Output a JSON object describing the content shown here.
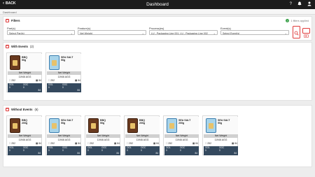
{
  "header": {
    "back_label": "BACK",
    "title": "Dashboard"
  },
  "breadcrumb": "Dashboard",
  "filters": {
    "title": "Filters",
    "applied_text": "1 filters applied",
    "fields": [
      {
        "label": "Part(s)",
        "value": "Select Part(s)"
      },
      {
        "label": "Feature(s)",
        "value": "Net Weight"
      },
      {
        "label": "Process(es)",
        "value": "LU - Packaging Line 001, LU - Packaging Line 002"
      },
      {
        "label": "Event(s)",
        "value": "Select Event(s)"
      }
    ]
  },
  "with_events": {
    "title": "With Events",
    "count": "(2)",
    "cards": [
      {
        "flavor": "BBQ",
        "weight": "50g",
        "bag": "dark",
        "measure": "Net Weight",
        "value": "11946 AGG",
        "left_count": "252",
        "right_count": "84",
        "stat1": "OOL",
        "stat1_val": "0",
        "stat2": "OOC",
        "stat2_val": "0",
        "stat3": "84"
      },
      {
        "flavor": "SEA SALT",
        "weight": "50g",
        "bag": "light",
        "measure": "Net Weight",
        "value": "11946 AGG",
        "left_count": "252",
        "right_count": "84",
        "stat1": "OOL",
        "stat1_val": "0",
        "stat2": "OOC",
        "stat2_val": "0",
        "stat3": "84"
      }
    ]
  },
  "without_events": {
    "title": "Without Events",
    "count": "(6)",
    "cards": [
      {
        "flavor": "BBQ",
        "weight": "200g",
        "bag": "dark",
        "measure": "Net Weight",
        "value": "11946 AGG",
        "left_count": "252",
        "right_count": "84",
        "stat1": "OOL",
        "stat1_val": "0",
        "stat2": "OOC",
        "stat2_val": "0",
        "stat3": "84"
      },
      {
        "flavor": "SEA SALT",
        "weight": "50g",
        "bag": "light",
        "measure": "Net Weight",
        "value": "11946 AGG",
        "left_count": "252",
        "right_count": "84",
        "stat1": "OOL",
        "stat1_val": "0",
        "stat2": "OOC",
        "stat2_val": "0",
        "stat3": "84"
      },
      {
        "flavor": "BBQ",
        "weight": "50g",
        "bag": "dark",
        "measure": "Net Weight",
        "value": "11946 AGG",
        "left_count": "252",
        "right_count": "84",
        "stat1": "OOL",
        "stat1_val": "0",
        "stat2": "OOC",
        "stat2_val": "0",
        "stat3": "84"
      },
      {
        "flavor": "BBQ",
        "weight": "200g",
        "bag": "dark",
        "measure": "Net Weight",
        "value": "11946 AGG",
        "left_count": "252",
        "right_count": "84",
        "stat1": "OOL",
        "stat1_val": "0",
        "stat2": "OOC",
        "stat2_val": "0",
        "stat3": "84"
      },
      {
        "flavor": "SEA SALT",
        "weight": "200g",
        "bag": "light",
        "measure": "Net Weight",
        "value": "11946 AGG",
        "left_count": "252",
        "right_count": "84",
        "stat1": "OOL",
        "stat1_val": "0",
        "stat2": "OOC",
        "stat2_val": "0",
        "stat3": "84"
      },
      {
        "flavor": "SEA SALT",
        "weight": "50g",
        "bag": "light",
        "measure": "Net Weight",
        "value": "11946 AGG",
        "left_count": "252",
        "right_count": "84",
        "stat1": "OOL",
        "stat1_val": "0",
        "stat2": "OOC",
        "stat2_val": "0",
        "stat3": "84"
      }
    ]
  },
  "icons": {
    "back": "chevron-left-icon",
    "help": "help-icon",
    "notifications": "bell-icon",
    "user": "user-icon",
    "search": "search-icon",
    "clear": "clear-icon"
  },
  "colors": {
    "topbar": "#1c1c1c",
    "accent": "#e03a3a",
    "stats_bar": "#34495e",
    "applied": "#3aa14a"
  }
}
